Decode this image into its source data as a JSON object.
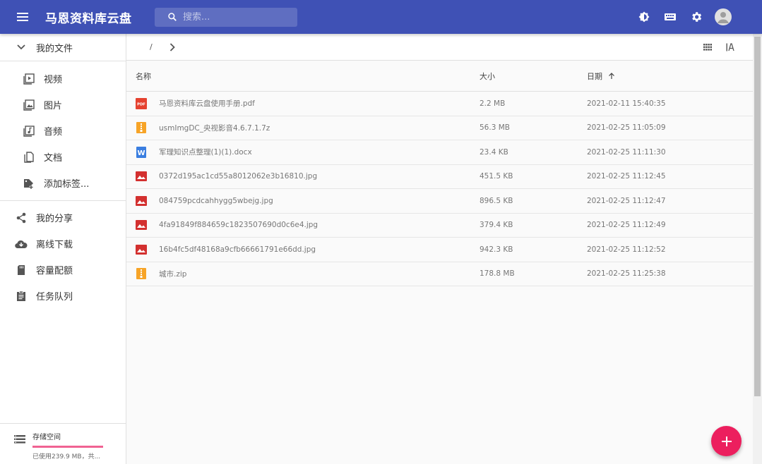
{
  "app": {
    "title": "马恩资料库云盘",
    "search_placeholder": "搜索...",
    "accent": "#3f51b5",
    "fab_color": "#ec1f5e"
  },
  "header_actions": [
    {
      "name": "theme-toggle",
      "icon": "brightness-icon"
    },
    {
      "name": "keyboard",
      "icon": "keyboard-icon"
    },
    {
      "name": "settings",
      "icon": "gear-icon"
    },
    {
      "name": "account",
      "icon": "avatar-icon"
    }
  ],
  "sidebar": {
    "my_files": "我的文件",
    "sub_items": [
      {
        "label": "视频",
        "icon": "video-icon"
      },
      {
        "label": "图片",
        "icon": "image-icon"
      },
      {
        "label": "音频",
        "icon": "audio-icon"
      },
      {
        "label": "文档",
        "icon": "document-icon"
      },
      {
        "label": "添加标签...",
        "icon": "tag-add-icon"
      }
    ],
    "items": [
      {
        "label": "我的分享",
        "icon": "share-icon"
      },
      {
        "label": "离线下载",
        "icon": "cloud-download-icon"
      },
      {
        "label": "容量配额",
        "icon": "sd-card-icon"
      },
      {
        "label": "任务队列",
        "icon": "clipboard-icon"
      }
    ],
    "storage": {
      "title": "存储空间",
      "detail": "已使用239.9 MB，共...",
      "used_fraction": 1.0
    }
  },
  "toolbar": {
    "path_root": "/"
  },
  "table": {
    "headers": {
      "name": "名称",
      "size": "大小",
      "date": "日期"
    },
    "rows": [
      {
        "name": "马恩资料库云盘使用手册.pdf",
        "size": "2.2 MB",
        "date": "2021-02-11 15:40:35",
        "type": "pdf"
      },
      {
        "name": "usmImgDC_央视影音4.6.7.1.7z",
        "size": "56.3 MB",
        "date": "2021-02-25 11:05:09",
        "type": "zip"
      },
      {
        "name": "军理知识点整理(1)(1).docx",
        "size": "23.4 KB",
        "date": "2021-02-25 11:11:30",
        "type": "word"
      },
      {
        "name": "0372d195ac1cd55a8012062e3b16810.jpg",
        "size": "451.5 KB",
        "date": "2021-02-25 11:12:45",
        "type": "image"
      },
      {
        "name": "084759pcdcahhygg5wbejg.jpg",
        "size": "896.5 KB",
        "date": "2021-02-25 11:12:47",
        "type": "image"
      },
      {
        "name": "4fa91849f884659c1823507690d0c6e4.jpg",
        "size": "379.4 KB",
        "date": "2021-02-25 11:12:49",
        "type": "image"
      },
      {
        "name": "16b4fc5df48168a9cfb66661791e66dd.jpg",
        "size": "942.3 KB",
        "date": "2021-02-25 11:12:52",
        "type": "image"
      },
      {
        "name": "城市.zip",
        "size": "178.8 MB",
        "date": "2021-02-25 11:25:38",
        "type": "zip"
      }
    ]
  }
}
